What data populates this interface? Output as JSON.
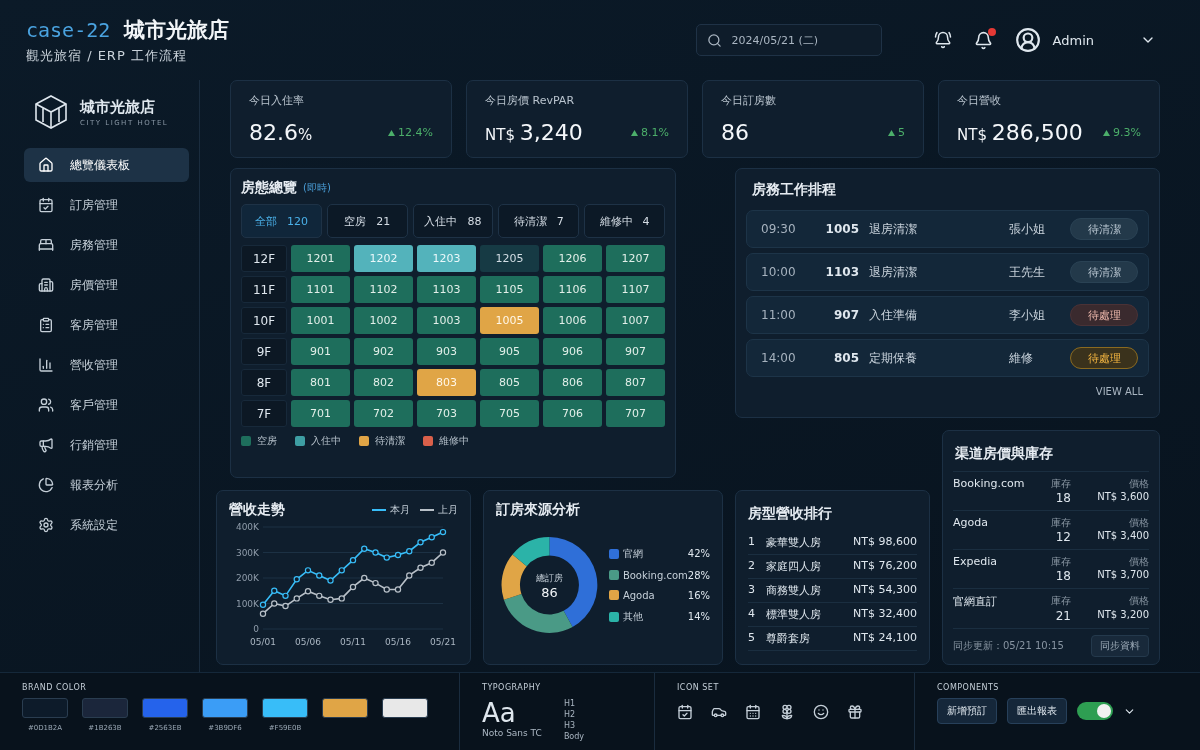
{
  "header": {
    "case": "case-22",
    "title": "城市光旅店",
    "subtitle": "觀光旅宿 / ERP 工作流程",
    "search": {
      "value": "2024/05/21 (二)"
    },
    "notification_badge": true,
    "user": "Admin"
  },
  "sidebar": {
    "logo": {
      "name": "城市光旅店",
      "tagline": "CITY LIGHT HOTEL"
    },
    "items": [
      {
        "label": "總覽儀表板",
        "selected": true
      },
      {
        "label": "訂房管理",
        "selected": false
      },
      {
        "label": "房務管理",
        "selected": false
      },
      {
        "label": "房價管理",
        "selected": false
      },
      {
        "label": "客房管理",
        "selected": false
      },
      {
        "label": "營收管理",
        "selected": false
      },
      {
        "label": "客戶管理",
        "selected": false
      },
      {
        "label": "行銷管理",
        "selected": false
      },
      {
        "label": "報表分析",
        "selected": false
      },
      {
        "label": "系統設定",
        "selected": false
      }
    ]
  },
  "kpis": [
    {
      "label": "今日入住率",
      "value": "82.6",
      "unit": "%",
      "delta": "12.4%"
    },
    {
      "label": "今日房價 RevPAR",
      "prefix": "NT$",
      "value": "3,240",
      "delta": "8.1%"
    },
    {
      "label": "今日訂房數",
      "value": "86",
      "delta": "5"
    },
    {
      "label": "今日營收",
      "prefix": "NT$",
      "value": "286,500",
      "delta": "9.3%"
    }
  ],
  "room_overview": {
    "title": "房態總覽",
    "tag": "(即時)",
    "filters": [
      {
        "label": "全部",
        "count": "120",
        "selected": true
      },
      {
        "label": "空房",
        "count": "21",
        "selected": false
      },
      {
        "label": "入住中",
        "count": "88",
        "selected": false
      },
      {
        "label": "待清潔",
        "count": "7",
        "selected": false
      },
      {
        "label": "維修中",
        "count": "4",
        "selected": false
      }
    ],
    "floors": [
      {
        "label": "12F",
        "rooms": [
          {
            "number": "1201",
            "kind": "vacant"
          },
          {
            "number": "1202",
            "kind": "occupied"
          },
          {
            "number": "1203",
            "kind": "occupied"
          },
          {
            "number": "1205",
            "kind": "blocked"
          },
          {
            "number": "1206",
            "kind": "vacant"
          },
          {
            "number": "1207",
            "kind": "vacant"
          }
        ]
      },
      {
        "label": "11F",
        "rooms": [
          {
            "number": "1101",
            "kind": "vacant"
          },
          {
            "number": "1102",
            "kind": "vacant"
          },
          {
            "number": "1103",
            "kind": "vacant"
          },
          {
            "number": "1105",
            "kind": "vacant"
          },
          {
            "number": "1106",
            "kind": "vacant"
          },
          {
            "number": "1107",
            "kind": "vacant"
          }
        ]
      },
      {
        "label": "10F",
        "rooms": [
          {
            "number": "1001",
            "kind": "vacant"
          },
          {
            "number": "1002",
            "kind": "vacant"
          },
          {
            "number": "1003",
            "kind": "vacant"
          },
          {
            "number": "1005",
            "kind": "cleaning"
          },
          {
            "number": "1006",
            "kind": "vacant"
          },
          {
            "number": "1007",
            "kind": "vacant"
          }
        ]
      },
      {
        "label": "9F",
        "rooms": [
          {
            "number": "901",
            "kind": "vacant"
          },
          {
            "number": "902",
            "kind": "vacant"
          },
          {
            "number": "903",
            "kind": "vacant"
          },
          {
            "number": "905",
            "kind": "vacant"
          },
          {
            "number": "906",
            "kind": "vacant"
          },
          {
            "number": "907",
            "kind": "vacant"
          }
        ]
      },
      {
        "label": "8F",
        "rooms": [
          {
            "number": "801",
            "kind": "vacant"
          },
          {
            "number": "802",
            "kind": "vacant"
          },
          {
            "number": "803",
            "kind": "cleaning"
          },
          {
            "number": "805",
            "kind": "vacant"
          },
          {
            "number": "806",
            "kind": "vacant"
          },
          {
            "number": "807",
            "kind": "vacant"
          }
        ]
      },
      {
        "label": "7F",
        "rooms": [
          {
            "number": "701",
            "kind": "vacant"
          },
          {
            "number": "702",
            "kind": "vacant"
          },
          {
            "number": "703",
            "kind": "vacant"
          },
          {
            "number": "705",
            "kind": "vacant"
          },
          {
            "number": "706",
            "kind": "vacant"
          },
          {
            "number": "707",
            "kind": "vacant"
          }
        ]
      }
    ],
    "legend": [
      {
        "label": "空房",
        "color": "#1e6e5c"
      },
      {
        "label": "入住中",
        "color": "#3e9ea3"
      },
      {
        "label": "待清潔",
        "color": "#e0a546"
      },
      {
        "label": "維修中",
        "color": "#d9604a"
      }
    ]
  },
  "schedule": {
    "title": "房務工作排程",
    "rows": [
      {
        "time": "09:30",
        "room": "1005",
        "task": "退房清潔",
        "person": "張小姐",
        "status": "待清潔",
        "kind": "neutral"
      },
      {
        "time": "10:00",
        "room": "1103",
        "task": "退房清潔",
        "person": "王先生",
        "status": "待清潔",
        "kind": "neutral"
      },
      {
        "time": "11:00",
        "room": "907",
        "task": "入住準備",
        "person": "李小姐",
        "status": "待處理",
        "kind": "alert"
      },
      {
        "time": "14:00",
        "room": "805",
        "task": "定期保養",
        "person": "維修",
        "status": "待處理",
        "kind": "warning"
      }
    ],
    "view_all": "VIEW ALL"
  },
  "revenue_trend": {
    "title": "營收走勢",
    "chart_data": {
      "type": "line",
      "categories": [
        "05/01",
        null,
        null,
        null,
        "05/06",
        null,
        null,
        null,
        "05/11",
        null,
        null,
        null,
        "05/16",
        null,
        null,
        null,
        "05/21"
      ],
      "series": [
        {
          "name": "本月",
          "color": "#38bdf8",
          "marker": "circle",
          "values": [
            95,
            150,
            130,
            195,
            230,
            210,
            190,
            230,
            270,
            315,
            300,
            280,
            290,
            305,
            340,
            360,
            380
          ]
        },
        {
          "name": "上月",
          "color": "#b8c0c8",
          "marker": "circle",
          "values": [
            60,
            100,
            90,
            120,
            148,
            130,
            115,
            120,
            165,
            200,
            180,
            155,
            155,
            210,
            240,
            260,
            300
          ]
        }
      ],
      "ylim": [
        0,
        400
      ],
      "grid": true,
      "yticks": [
        {
          "value": 0,
          "label": "0"
        },
        {
          "value": 100,
          "label": "100K"
        },
        {
          "value": 200,
          "label": "200K"
        },
        {
          "value": 300,
          "label": "300K"
        },
        {
          "value": 400,
          "label": "400K"
        }
      ]
    }
  },
  "booking_sources": {
    "title": "訂房來源分析",
    "center_label": "總訂房",
    "center_value": "86",
    "legend": [
      {
        "label": "官網",
        "percent": "42%",
        "color": "#2f6fd8"
      },
      {
        "label": "Booking.com",
        "percent": "28%",
        "color": "#4a9a86"
      },
      {
        "label": "Agoda",
        "percent": "16%",
        "color": "#e0a546"
      },
      {
        "label": "其他",
        "percent": "14%",
        "color": "#2bb3a8"
      }
    ],
    "chart_data": {
      "type": "donut",
      "values": [
        42,
        28,
        16,
        14
      ]
    }
  },
  "room_type_ranking": {
    "title": "房型營收排行",
    "rows": [
      {
        "rank": "1",
        "name": "豪華雙人房",
        "amount": "NT$ 98,600"
      },
      {
        "rank": "2",
        "name": "家庭四人房",
        "amount": "NT$ 76,200"
      },
      {
        "rank": "3",
        "name": "商務雙人房",
        "amount": "NT$ 54,300"
      },
      {
        "rank": "4",
        "name": "標準雙人房",
        "amount": "NT$ 32,400"
      },
      {
        "rank": "5",
        "name": "尊爵套房",
        "amount": "NT$ 24,100"
      }
    ]
  },
  "channels": {
    "title": "渠道房價與庫存",
    "rows": [
      {
        "name": "Booking.com",
        "stock_label": "庫存",
        "stock": "18",
        "price_label": "價格",
        "price": "NT$ 3,600"
      },
      {
        "name": "Agoda",
        "stock_label": "庫存",
        "stock": "12",
        "price_label": "價格",
        "price": "NT$ 3,400"
      },
      {
        "name": "Expedia",
        "stock_label": "庫存",
        "stock": "18",
        "price_label": "價格",
        "price": "NT$ 3,700"
      },
      {
        "name": "官網直訂",
        "stock_label": "庫存",
        "stock": "21",
        "price_label": "價格",
        "price": "NT$ 3,200"
      }
    ],
    "sync_text": "同步更新：05/21 10:15",
    "sync_button": "同步資料"
  },
  "style_guide": {
    "brand": {
      "title": "BRAND COLOR",
      "swatches": [
        {
          "color": "#0d1b2a",
          "label": "#0D1B2A"
        },
        {
          "color": "#1b263b",
          "label": "#1B263B"
        },
        {
          "color": "#2563eb",
          "label": "#2563EB"
        },
        {
          "color": "#3b9df6",
          "label": "#3B9DF6"
        },
        {
          "color": "#38bdf8",
          "label": "#F59E0B"
        },
        {
          "color": "#e0a546"
        },
        {
          "color": "#e8e8e8"
        }
      ]
    },
    "typography": {
      "title": "TYPOGRAPHY",
      "sample": "Aa",
      "font_name": "Noto Sans TC",
      "levels": [
        "H1",
        "H2",
        "H3",
        "Body"
      ]
    },
    "icon_set": {
      "title": "ICON SET"
    },
    "components": {
      "title": "COMPONENTS",
      "buttons": [
        "新增預訂",
        "匯出報表"
      ],
      "toggle_on": true
    }
  }
}
